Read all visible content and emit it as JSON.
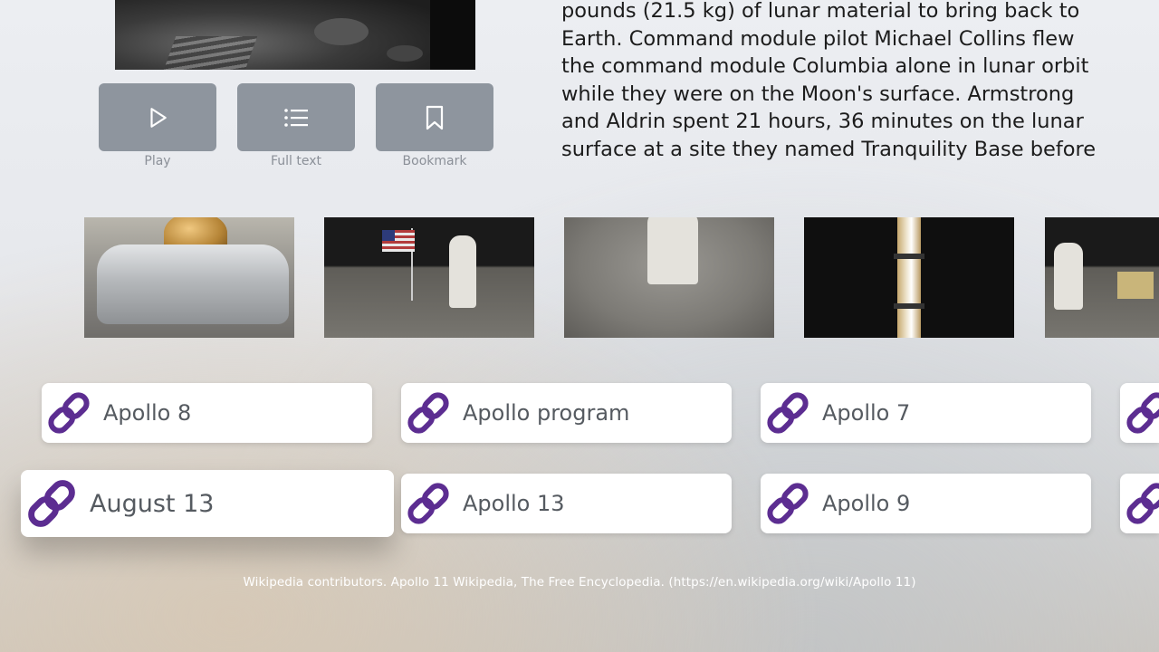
{
  "actions": {
    "play_label": "Play",
    "full_text_label": "Full text",
    "bookmark_label": "Bookmark"
  },
  "article": {
    "text": "pounds (21.5 kg) of lunar material to bring back to Earth. Command module pilot Michael Collins flew the command module Columbia alone in lunar orbit while they were on the Moon's surface. Armstrong and Aldrin spent 21 hours, 36 minutes on the lunar surface at a site they named Tranquility Base before"
  },
  "related_links": {
    "row1": [
      "Apollo 8",
      "Apollo program",
      "Apollo 7"
    ],
    "row2": [
      "August 13",
      "Apollo 13",
      "Apollo 9"
    ]
  },
  "citation": "Wikipedia contributors. Apollo 11 Wikipedia, The Free Encyclopedia. (https://en.wikipedia.org/wiki/Apollo 11)",
  "colors": {
    "link_icon": "#5c2d91",
    "action_button": "#8e959e"
  }
}
